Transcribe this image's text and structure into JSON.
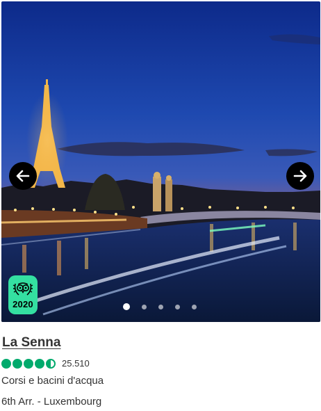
{
  "attraction": {
    "name": "La Senna",
    "rating_bubbles": 4.5,
    "review_count": "25.510",
    "category": "Corsi e bacini d'acqua",
    "location": "6th Arr. - Luxembourg"
  },
  "gallery": {
    "photo_count": 5,
    "active_photo_index": 0
  },
  "award": {
    "year": "2020",
    "icon": "travellers-choice-owl-icon"
  },
  "icons": {
    "prev": "arrow-left-icon",
    "next": "arrow-right-icon"
  },
  "colors": {
    "bubble_green": "#00aa6c",
    "award_green": "#34e0a1",
    "nav_button": "#000000"
  }
}
